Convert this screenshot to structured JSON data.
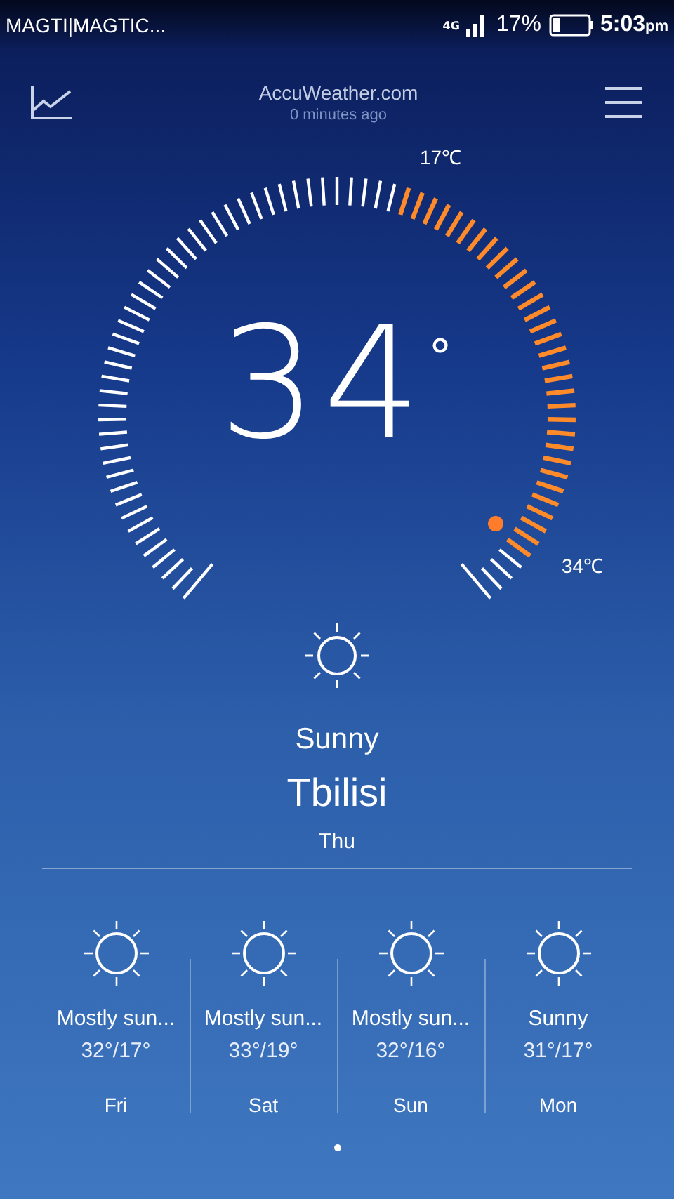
{
  "status_bar": {
    "carrier": "MAGTI|MAGTIC...",
    "network": "4G",
    "battery": "17%",
    "time": "5:03",
    "time_suffix": "pm"
  },
  "header": {
    "source": "AccuWeather.com",
    "updated": "0 minutes ago"
  },
  "current": {
    "temperature": "34",
    "degree": "°",
    "low_label": "17℃",
    "high_label": "34℃",
    "condition": "Sunny",
    "city": "Tbilisi",
    "day": "Thu"
  },
  "forecast": [
    {
      "condition": "Mostly sun...",
      "temps": "32°/17°",
      "day": "Fri"
    },
    {
      "condition": "Mostly sun...",
      "temps": "33°/19°",
      "day": "Sat"
    },
    {
      "condition": "Mostly sun...",
      "temps": "32°/16°",
      "day": "Sun"
    },
    {
      "condition": "Sunny",
      "temps": "31°/17°",
      "day": "Mon"
    }
  ],
  "pages": [
    {
      "selected": true
    }
  ]
}
